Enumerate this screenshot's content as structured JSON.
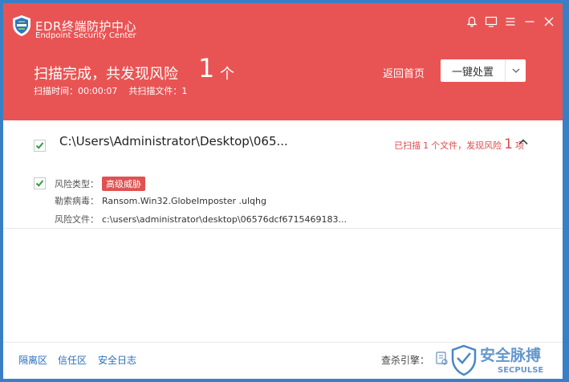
{
  "app": {
    "title": "EDR终端防护中心",
    "subtitle": "Endpoint Security Center"
  },
  "window_controls": [
    "bell-icon",
    "monitor-icon",
    "menu-icon",
    "minimize-icon",
    "close-icon"
  ],
  "header": {
    "scan_title": "扫描完成，共发现风险",
    "risk_count": "1",
    "risk_unit": "个",
    "scan_time_label": "扫描时间：",
    "scan_time": "00:00:07",
    "files_label": "共扫描文件：",
    "files_count": "1",
    "home_link": "返回首页",
    "action_button": "一键处置"
  },
  "result": {
    "checked": true,
    "path": "C:\\Users\\Administrator\\Desktop\\065...",
    "summary_prefix": "已扫描",
    "summary_files": "1",
    "summary_mid": "个文件，发现风险",
    "summary_risks": "1",
    "summary_unit": "项",
    "details": {
      "checked": true,
      "risk_type_label": "风险类型：",
      "risk_type_badge": "高级威胁",
      "virus_label": "勒索病毒：",
      "virus_value": "Ransom.Win32.GlobeImposter .ulqhg",
      "file_label": "风险文件：",
      "file_value": "c:\\users\\administrator\\desktop\\06576dcf6715469183..."
    }
  },
  "footer": {
    "links": [
      "隔离区",
      "信任区",
      "安全日志"
    ],
    "engine_label": "查杀引擎：",
    "watermark_text": "安全脉搏",
    "watermark_sub": "SECPULSE"
  },
  "colors": {
    "header_red": "#e85454",
    "check_green": "#2e9e3c",
    "link_blue": "#2a6ebb",
    "badge_red": "#e05252"
  }
}
